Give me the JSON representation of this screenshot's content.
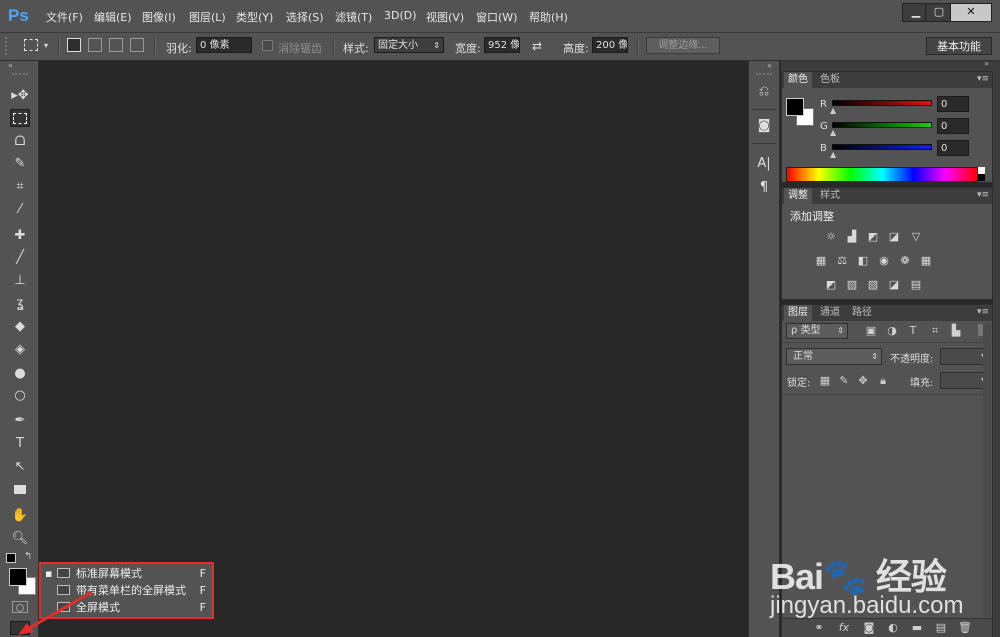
{
  "app": {
    "logo": "Ps"
  },
  "menu": [
    "文件(F)",
    "编辑(E)",
    "图像(I)",
    "图层(L)",
    "类型(Y)",
    "选择(S)",
    "滤镜(T)",
    "3D(D)",
    "视图(V)",
    "窗口(W)",
    "帮助(H)"
  ],
  "window_controls": {
    "minimize": "▁",
    "maximize": "▢",
    "close": "✕"
  },
  "options": {
    "feather_label": "羽化:",
    "feather_value": "0 像素",
    "antialias_label": "消除锯齿",
    "style_label": "样式:",
    "style_value": "固定大小",
    "width_label": "宽度:",
    "width_value": "952 像",
    "height_label": "高度:",
    "height_value": "200 像",
    "refine_edge": "调整边缘...",
    "workspace": "基本功能"
  },
  "tools": [
    "move-tool",
    "marquee-tool",
    "lasso-tool",
    "quick-select-tool",
    "crop-tool",
    "eyedropper-tool",
    "healing-brush-tool",
    "brush-tool",
    "clone-stamp-tool",
    "history-brush-tool",
    "eraser-tool",
    "paint-bucket-tool",
    "blur-tool",
    "dodge-tool",
    "pen-tool",
    "type-tool",
    "path-select-tool",
    "rectangle-tool",
    "hand-tool",
    "zoom-tool"
  ],
  "color_panel": {
    "tabs": [
      "颜色",
      "色板"
    ],
    "channels": [
      {
        "label": "R",
        "value": "0",
        "color": "#d42020"
      },
      {
        "label": "G",
        "value": "0",
        "color": "#20c020"
      },
      {
        "label": "B",
        "value": "0",
        "color": "#2030e0"
      }
    ]
  },
  "adjustments_panel": {
    "tabs": [
      "调整",
      "样式"
    ],
    "title": "添加调整"
  },
  "layers_panel": {
    "tabs": [
      "图层",
      "通道",
      "路径"
    ],
    "filter": "ρ 类型",
    "blend_mode": "正常",
    "opacity_label": "不透明度:",
    "lock_label": "锁定:",
    "fill_label": "填充:"
  },
  "screen_mode_menu": [
    {
      "label": "标准屏幕模式",
      "shortcut": "F",
      "selected": true
    },
    {
      "label": "带有菜单栏的全屏模式",
      "shortcut": "F",
      "selected": false
    },
    {
      "label": "全屏模式",
      "shortcut": "F",
      "selected": false
    }
  ],
  "watermark": {
    "logo": "Bai🐾 经验",
    "url": "jingyan.baidu.com"
  },
  "colors": {
    "highlight": "#e22d2d",
    "ps_blue": "#4ea6ff"
  }
}
